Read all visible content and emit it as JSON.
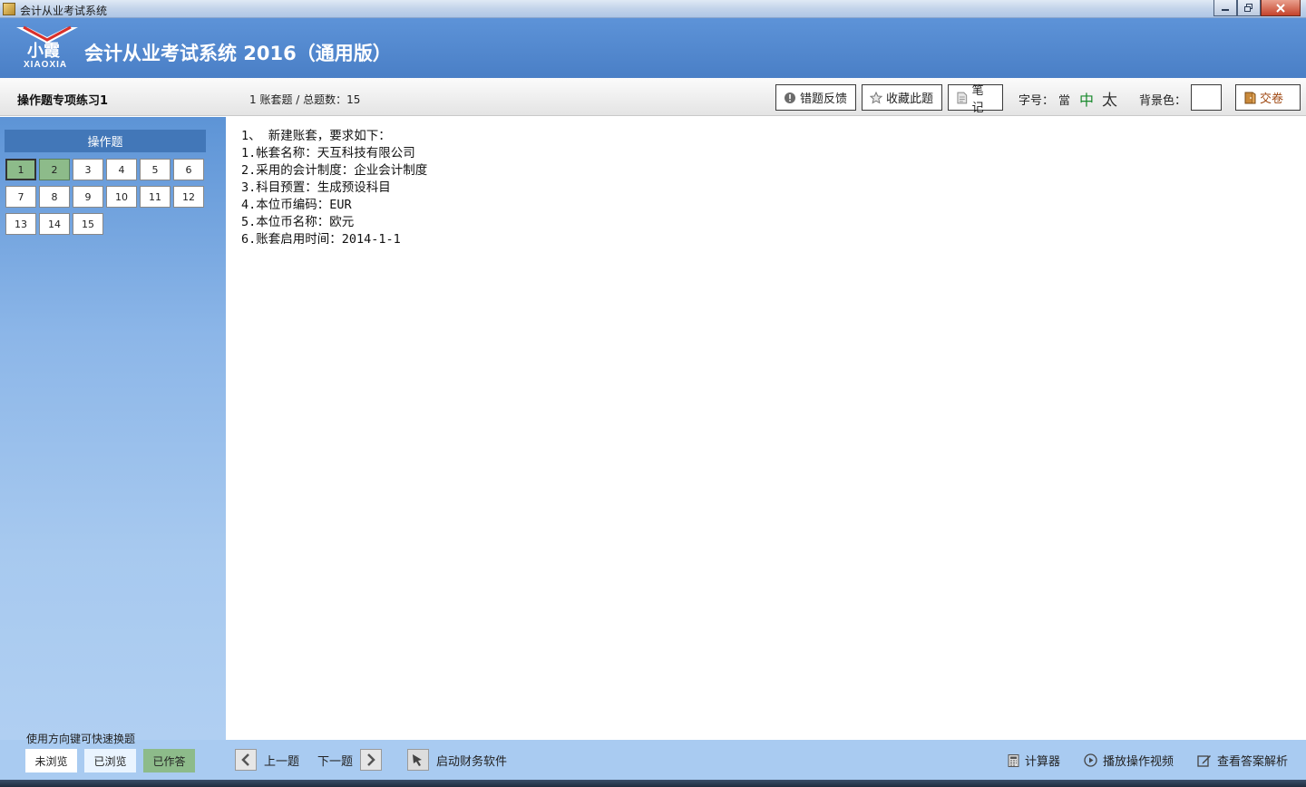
{
  "window": {
    "title": "会计从业考试系统"
  },
  "header": {
    "logo_text": "XIAOXIA",
    "logo_cn": "小霞",
    "app_title": "会计从业考试系统 2016（通用版）"
  },
  "toolbar": {
    "section_title": "操作题专项练习1",
    "counter": "1 账套题 / 总题数：15",
    "feedback_label": "错题反馈",
    "favorite_label": "收藏此题",
    "notes_label": "笔记",
    "font_label": "字号：",
    "font_small": "當",
    "font_mid": "中",
    "font_big": "太",
    "bg_label": "背景色：",
    "submit_label": "交卷"
  },
  "sidebar": {
    "header": "操作题",
    "questions": [
      "1",
      "2",
      "3",
      "4",
      "5",
      "6",
      "7",
      "8",
      "9",
      "10",
      "11",
      "12",
      "13",
      "14",
      "15"
    ],
    "current": "1",
    "answered": [
      "1",
      "2"
    ]
  },
  "question": {
    "lines": [
      "1、 新建账套，要求如下：",
      "1.帐套名称：天互科技有限公司",
      "2.采用的会计制度：企业会计制度",
      "3.科目预置：生成预设科目",
      "4.本位币编码：EUR",
      "5.本位币名称：欧元",
      "6.账套启用时间：2014-1-1"
    ]
  },
  "footer": {
    "hint": "使用方向键可快速换题",
    "legend_unviewed": "未浏览",
    "legend_viewed": "已浏览",
    "legend_answered": "已作答",
    "prev_label": "上一题",
    "next_label": "下一题",
    "launch_label": "启动财务软件",
    "calculator_label": "计算器",
    "video_label": "播放操作视频",
    "answer_label": "查看答案解析"
  },
  "colors": {
    "header_blue": "#4a7fc6",
    "answered_green": "#8dbb8a",
    "font_mid_green": "#1a8a2e"
  }
}
